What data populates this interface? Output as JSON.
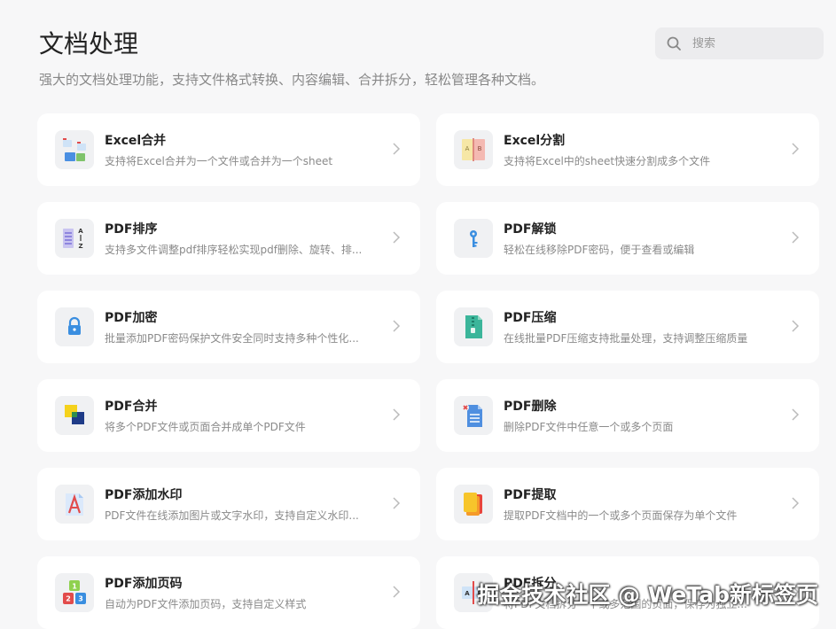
{
  "header": {
    "title": "文档处理",
    "description": "强大的文档处理功能，支持文件格式转换、内容编辑、合并拆分，轻松管理各种文档。"
  },
  "search": {
    "placeholder": "搜索",
    "value": ""
  },
  "tools": [
    {
      "name": "Excel合并",
      "desc": "支持将Excel合并为一个文件或合并为一个sheet",
      "icon": "excel-merge-icon"
    },
    {
      "name": "Excel分割",
      "desc": "支持将Excel中的sheet快速分割成多个文件",
      "icon": "excel-split-icon"
    },
    {
      "name": "PDF排序",
      "desc": "支持多文件调整pdf排序轻松实现pdf删除、旋转、排...",
      "icon": "pdf-sort-icon"
    },
    {
      "name": "PDF解锁",
      "desc": "轻松在线移除PDF密码，便于查看或编辑",
      "icon": "pdf-unlock-icon"
    },
    {
      "name": "PDF加密",
      "desc": "批量添加PDF密码保护文件安全同时支持多种个性化...",
      "icon": "pdf-encrypt-icon"
    },
    {
      "name": "PDF压缩",
      "desc": "在线批量PDF压缩支持批量处理，支持调整压缩质量",
      "icon": "pdf-compress-icon"
    },
    {
      "name": "PDF合并",
      "desc": "将多个PDF文件或页面合并成单个PDF文件",
      "icon": "pdf-merge-icon"
    },
    {
      "name": "PDF删除",
      "desc": "删除PDF文件中任意一个或多个页面",
      "icon": "pdf-delete-icon"
    },
    {
      "name": "PDF添加水印",
      "desc": "PDF文件在线添加图片或文字水印，支持自定义水印...",
      "icon": "pdf-watermark-icon"
    },
    {
      "name": "PDF提取",
      "desc": "提取PDF文档中的一个或多个页面保存为单个文件",
      "icon": "pdf-extract-icon"
    },
    {
      "name": "PDF添加页码",
      "desc": "自动为PDF文件添加页码，支持自定义样式",
      "icon": "pdf-page-number-icon"
    },
    {
      "name": "PDF拆分",
      "desc": "将PDF文档拆分一个或多范围的页面，保存为独立...",
      "icon": "pdf-split-icon"
    }
  ],
  "watermark": "掘金技术社区 @ WeTab新标签页",
  "colors": {
    "background": "#f7f7f8",
    "card": "#ffffff",
    "search_bg": "#ececee"
  }
}
